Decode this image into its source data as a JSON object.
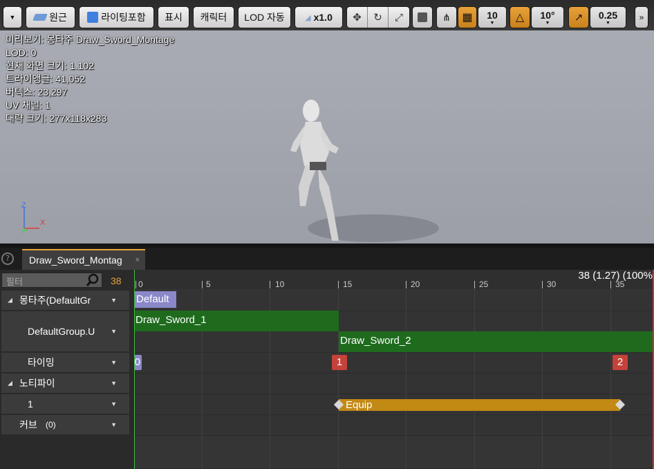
{
  "toolbar": {
    "perspective_label": "원근",
    "lighting_label": "라이팅포함",
    "show_label": "표시",
    "character_label": "캐릭터",
    "lod_label": "LOD 자동",
    "speed_label": "x1.0",
    "grid_snap_value": "10",
    "rotation_snap_value": "10°",
    "scale_snap_value": "0.25",
    "overflow_label": "»"
  },
  "stats": {
    "line1": "미리보기: 몽타주 Draw_Sword_Montage",
    "line2": "LOD: 0",
    "line3": "현재 화면 크기: 1.102",
    "line4": "트라이앵글: 41,052",
    "line5": "버텍스: 23,297",
    "line6": "UV 채널: 1",
    "line7": "대략 크기: 277x118x283"
  },
  "axis": {
    "z": "Z",
    "x": "X",
    "y": "Y"
  },
  "tab": {
    "title": "Draw_Sword_Montag",
    "close": "×"
  },
  "left": {
    "filter_placeholder": "필터",
    "frame_count": "38",
    "rows": [
      {
        "label": "몽타주(DefaultGr"
      },
      {
        "label": "DefaultGroup.U"
      },
      {
        "label": "타이밍"
      },
      {
        "label": "노티파이"
      },
      {
        "label": "1"
      },
      {
        "label": "커브",
        "count": "(0)"
      }
    ]
  },
  "timeline": {
    "frame_readout": "38 (1.27) (100%",
    "ticks": [
      "0",
      "5",
      "10",
      "15",
      "20",
      "25",
      "30",
      "35"
    ],
    "section": "Default",
    "segment1": "Draw_Sword_1",
    "segment2": "Draw_Sword_2",
    "marker0": "0",
    "marker1": "1",
    "marker2": "2",
    "notify": "Equip"
  },
  "colors": {
    "accent": "#e8a23a",
    "segment_green": "#1e6b1e",
    "marker_red": "#c4423a",
    "notify_gold": "#c28915",
    "section_purple": "#8a88c8"
  }
}
